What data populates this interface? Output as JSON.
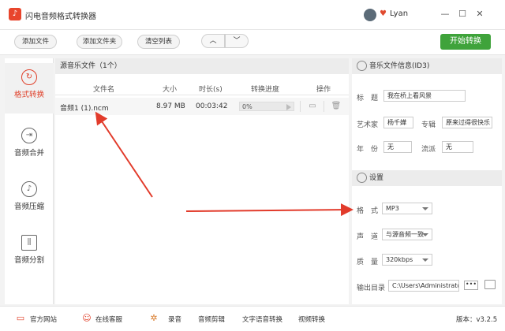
{
  "app": {
    "title": "闪电音频格式转换器",
    "logo_icon": "music-note-icon",
    "user": "Lyan",
    "window_controls": [
      "—",
      "☐",
      "✕"
    ]
  },
  "toolbar": {
    "add_file": "添加文件",
    "add_folder": "添加文件夹",
    "clear_list": "清空列表",
    "up": "︿",
    "down": "﹀",
    "start": "开始转换"
  },
  "sidebar": [
    {
      "label": "格式转换",
      "icon": "refresh-icon",
      "active": true
    },
    {
      "label": "音频合并",
      "icon": "merge-icon",
      "active": false
    },
    {
      "label": "音频压缩",
      "icon": "compress-icon",
      "active": false
    },
    {
      "label": "音频分割",
      "icon": "split-icon",
      "active": false
    }
  ],
  "file_panel": {
    "header": "源音乐文件（1个）",
    "columns": {
      "name": "文件名",
      "size": "大小",
      "duration": "时长(s)",
      "progress": "转换进度",
      "action": "操作"
    },
    "rows": [
      {
        "name": "音频1 (1).ncm",
        "size": "8.97 MB",
        "duration": "00:03:42",
        "progress": "0%"
      }
    ]
  },
  "info": {
    "header": "音乐文件信息(ID3)",
    "title_label": "标　题",
    "title_value": "我在桥上看风景",
    "artist_label": "艺术家",
    "artist_value": "杨千嬅",
    "album_label": "专辑",
    "album_value": "原来过得很快乐",
    "year_label": "年　份",
    "year_value": "无",
    "genre_label": "流派",
    "genre_value": "无"
  },
  "settings": {
    "header": "设置",
    "format_label": "格　式",
    "format_value": "MP3",
    "channel_label": "声　道",
    "channel_value": "与源音频一致",
    "quality_label": "质　量",
    "quality_value": "320kbps",
    "output_label": "输出目录",
    "output_value": "C:\\Users\\Administrator",
    "more": "•••"
  },
  "footer": {
    "website": "官方网站",
    "service": "在线客服",
    "record": "录音",
    "edit": "音频剪辑",
    "tts": "文字语音转换",
    "video": "视频转换",
    "version": "版本：v3.2.5"
  },
  "colors": {
    "accent": "#e0402a",
    "start_button": "#3fa33b"
  }
}
